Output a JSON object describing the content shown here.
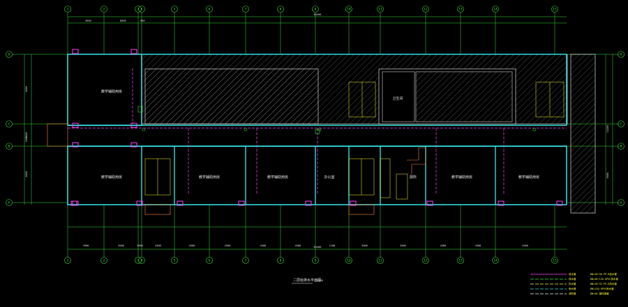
{
  "drawing": {
    "title": "二层给排水平面图",
    "scale": "1:100",
    "top_total_dim": "64400",
    "bottom_total_dim": "64400"
  },
  "axes_top": [
    "1",
    "2",
    "3",
    "4",
    "5",
    "6",
    "7",
    "8",
    "9",
    "10",
    "11",
    "12",
    "13",
    "14",
    "15"
  ],
  "axes_left": [
    "D",
    "C",
    "B",
    "A"
  ],
  "rooms": {
    "classroom_large": "教学辅助用房",
    "classroom": "教学辅助用房",
    "office": "办公室",
    "toilet": "卫生间",
    "toilet2": "厕所"
  },
  "top_dims": [
    "3600",
    "8000",
    "900"
  ],
  "bottom_dims": [
    "3900",
    "3600",
    "3600",
    "4500",
    "4500",
    "4500",
    "4500",
    "4500",
    "2100",
    "3600",
    "3600",
    "4500",
    "4500",
    "4500",
    "4500",
    "2100"
  ],
  "left_dims": [
    "6000",
    "2400",
    "1800",
    "6000"
  ],
  "right_dims": [
    "15200",
    "6000"
  ],
  "legend": [
    {
      "color": "#ff44ff",
      "name": "给水管",
      "desc": "DN=20~50 PP-R给水管"
    },
    {
      "color": "#39e639",
      "name": "排水管",
      "desc": "DN=50~110 UPVC排水管"
    },
    {
      "color": "#ffff33",
      "name": "热水管",
      "desc": "DN=20~32 PP-R热水管"
    },
    {
      "color": "#33dddd",
      "name": "雨水管",
      "desc": "DN=110 UPVC雨水管"
    },
    {
      "color": "#ffffff",
      "name": "消防管",
      "desc": "DN=65 镀锌钢管"
    }
  ],
  "colors": {
    "wall": "#33dddd",
    "grid": "#39e639",
    "pipe_water": "#ff44ff",
    "pipe_hot": "#ffff33",
    "text": "#ffffff",
    "hatch": "#ffffff"
  }
}
